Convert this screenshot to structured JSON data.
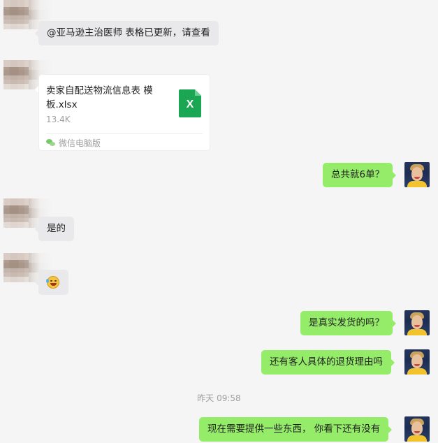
{
  "messages": {
    "m1": {
      "text": "@亚马逊主治医师  表格已更新，请查看"
    },
    "file": {
      "name": "卖家自配送物流信息表 模板.xlsx",
      "size": "13.4K",
      "source": "微信电脑版",
      "icon": "excel-file-icon",
      "icon_letter": "X"
    },
    "m2": {
      "text": "总共就6单？"
    },
    "m3": {
      "text": "是的"
    },
    "m4": {
      "emoji": "laughing-crying-emoji"
    },
    "m5": {
      "text": "是真实发货的吗？"
    },
    "m6": {
      "text": "还有客人具体的退货理由吗"
    },
    "timestamp": "昨天 09:58",
    "m7": {
      "text": "现在需要提供一些东西， 你看下还有没有"
    }
  },
  "colors": {
    "background": "#f5f5f5",
    "incoming_bubble": "#e9e9eb",
    "outgoing_bubble": "#95ec69",
    "excel_green": "#1aa653"
  }
}
